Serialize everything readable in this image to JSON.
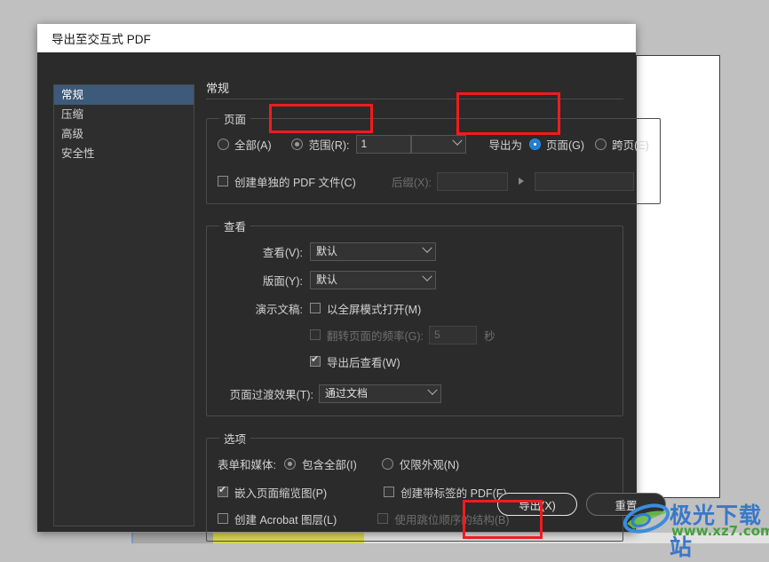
{
  "window": {
    "title": "导出至交互式 PDF"
  },
  "sidebar": {
    "items": [
      {
        "label": "常规",
        "selected": true
      },
      {
        "label": "压缩",
        "selected": false
      },
      {
        "label": "高级",
        "selected": false
      },
      {
        "label": "安全性",
        "selected": false
      }
    ]
  },
  "pane": {
    "title": "常规",
    "pages_group": {
      "legend": "页面",
      "all_label": "全部(A)",
      "range_label": "范围(R):",
      "range_value": "1",
      "range_dropdown_value": "",
      "separate_pdf_label": "创建单独的 PDF 文件(C)",
      "suffix_label": "后缀(X):",
      "suffix_value": "",
      "suffix_value2": "",
      "export_as_label": "导出为",
      "export_pages_label": "页面(G)",
      "export_spreads_label": "跨页(E)"
    },
    "view_group": {
      "legend": "查看",
      "view_label": "查看(V):",
      "view_value": "默认",
      "layout_label": "版面(Y):",
      "layout_value": "默认",
      "presentation_label": "演示文稿:",
      "fullscreen_label": "以全屏模式打开(M)",
      "flip_label": "翻转页面的频率(G):",
      "flip_value": "5",
      "seconds_label": "秒",
      "view_after_export_label": "导出后查看(W)",
      "transition_label": "页面过渡效果(T):",
      "transition_value": "通过文档"
    },
    "options_group": {
      "legend": "选项",
      "forms_media_label": "表单和媒体:",
      "include_all_label": "包含全部(I)",
      "appearance_only_label": "仅限外观(N)",
      "embed_thumbs_label": "嵌入页面缩览图(P)",
      "tagged_pdf_label": "创建带标签的 PDF(F)",
      "acrobat_layers_label": "创建 Acrobat 图层(L)",
      "tab_order_label": "使用跳位顺序的结构(B)"
    }
  },
  "buttons": {
    "export": "导出(X)",
    "reset": "重置"
  },
  "watermark": {
    "title": "极光下载站",
    "url": "www.xz7.com"
  },
  "colors": {
    "accent": "#1f7fd4",
    "annotation": "#f01c1c",
    "selection": "#3d5a7a"
  }
}
